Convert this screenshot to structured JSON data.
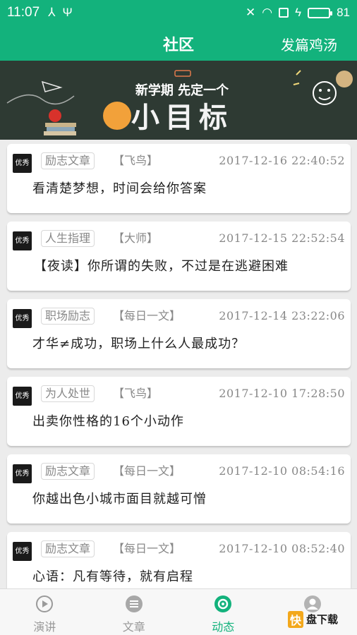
{
  "status_bar": {
    "time": "11:07",
    "battery_level": "81",
    "battery_fraction": 0.81
  },
  "header": {
    "title": "社区",
    "action_label": "发篇鸡汤"
  },
  "banner": {
    "line1": "新学期 先定一个",
    "line2": "小目标"
  },
  "posts": [
    {
      "avatar_text": "优秀",
      "category": "励志文章",
      "author": "【飞鸟】",
      "date": "2017-12-16 22:40:52",
      "title": "看清楚梦想，时间会给你答案"
    },
    {
      "avatar_text": "优秀",
      "category": "人生指理",
      "author": "【大师】",
      "date": "2017-12-15 22:52:54",
      "title": "【夜读】你所谓的失败，不过是在逃避困难"
    },
    {
      "avatar_text": "优秀",
      "category": "职场励志",
      "author": "【每日一文】",
      "date": "2017-12-14 23:22:06",
      "title": "才华≠成功，职场上什么人最成功？"
    },
    {
      "avatar_text": "优秀",
      "category": "为人处世",
      "author": "【飞鸟】",
      "date": "2017-12-10 17:28:50",
      "title": "出卖你性格的16个小动作"
    },
    {
      "avatar_text": "优秀",
      "category": "励志文章",
      "author": "【每日一文】",
      "date": "2017-12-10 08:54:16",
      "title": "你越出色小城市面目就越可憎"
    },
    {
      "avatar_text": "优秀",
      "category": "励志文章",
      "author": "【每日一文】",
      "date": "2017-12-10 08:52:40",
      "title": "心语：凡有等待，就有启程"
    }
  ],
  "tabs": [
    {
      "label": "演讲",
      "icon": "play-icon",
      "active": false
    },
    {
      "label": "文章",
      "icon": "article-icon",
      "active": false
    },
    {
      "label": "动态",
      "icon": "feed-icon",
      "active": true
    },
    {
      "label": "",
      "icon": "profile-icon",
      "active": false
    }
  ],
  "watermark": {
    "brand": "快",
    "text": "盘下载"
  },
  "colors": {
    "primary": "#13b27c",
    "card_bg": "#ffffff",
    "page_bg": "#ececec",
    "tab_inactive": "#999999"
  }
}
